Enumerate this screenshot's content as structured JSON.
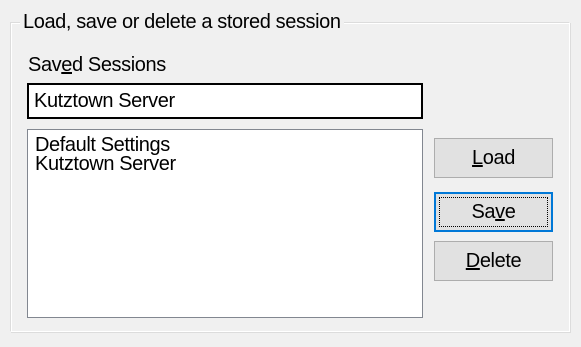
{
  "group": {
    "title": "Load, save or delete a stored session"
  },
  "saved_sessions": {
    "label_before": "Sav",
    "label_mnemonic": "e",
    "label_after": "d Sessions",
    "input_value": "Kutztown Server",
    "items": [
      {
        "label": "Default Settings"
      },
      {
        "label": "Kutztown Server"
      }
    ]
  },
  "buttons": {
    "load": {
      "mnemonic": "L",
      "rest": "oad"
    },
    "save": {
      "before": "Sa",
      "mnemonic": "v",
      "after": "e"
    },
    "delete": {
      "mnemonic": "D",
      "rest": "elete"
    }
  },
  "colors": {
    "background": "#f0f0f0",
    "focus_border": "#0078d7",
    "button_face": "#e1e1e1"
  }
}
